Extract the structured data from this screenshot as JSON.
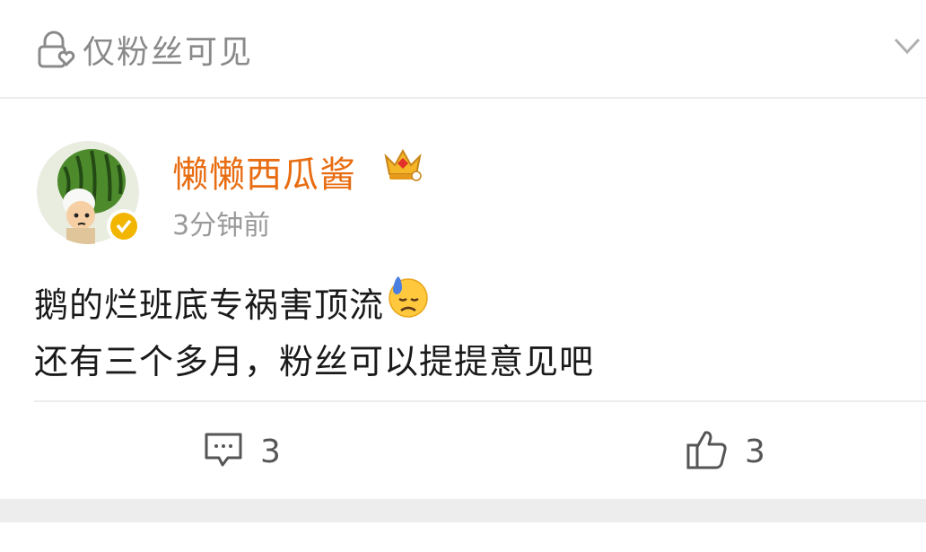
{
  "header": {
    "visibility_label": "仅粉丝可见"
  },
  "post": {
    "author": "懒懒西瓜酱",
    "time": "3分钟前",
    "lines": [
      "鹅的烂班底专祸害顶流",
      "还有三个多月，粉丝可以提提意见吧"
    ],
    "emoji": "sweat-sad-face-emoji"
  },
  "actions": {
    "comments": "3",
    "likes": "3"
  },
  "colors": {
    "author": "#e86d12",
    "muted": "#9a9a9a",
    "text": "#1a1a1a",
    "badge": "#f2b600"
  },
  "icons": [
    "lock-heart-icon",
    "chevron-down-icon",
    "crown-icon",
    "verified-icon",
    "comment-icon",
    "thumbs-up-icon"
  ]
}
